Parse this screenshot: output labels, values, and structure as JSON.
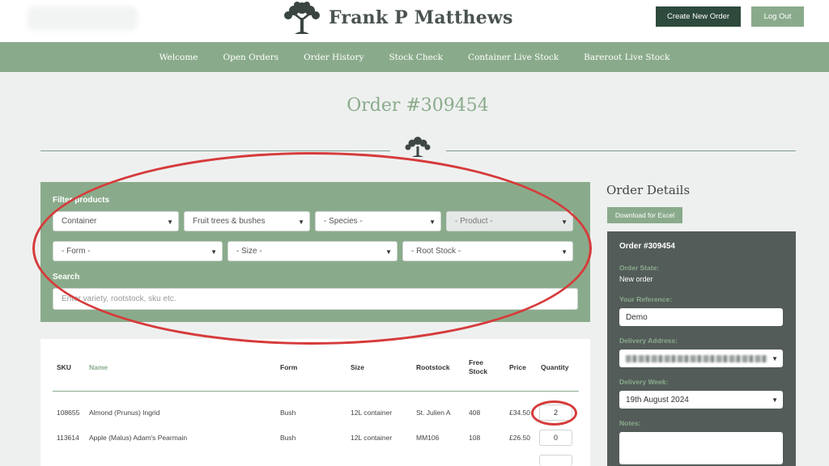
{
  "brand": {
    "name": "Frank P Matthews"
  },
  "header": {
    "new_order_label": "Create New Order",
    "logout_label": "Log Out"
  },
  "nav": [
    {
      "label": "Welcome"
    },
    {
      "label": "Open Orders"
    },
    {
      "label": "Order History"
    },
    {
      "label": "Stock Check"
    },
    {
      "label": "Container Live Stock"
    },
    {
      "label": "Bareroot Live Stock"
    }
  ],
  "page": {
    "title": "Order #309454"
  },
  "filters": {
    "label": "Filter products",
    "selects": [
      {
        "value": "Container"
      },
      {
        "value": "Fruit trees & bushes"
      },
      {
        "value": "- Species -"
      },
      {
        "value": "- Product -"
      },
      {
        "value": "- Form -"
      },
      {
        "value": "- Size -"
      },
      {
        "value": "- Root Stock -"
      }
    ],
    "search_label": "Search",
    "search_placeholder": "Enter variety, rootstock, sku etc."
  },
  "table": {
    "columns": [
      "SKU",
      "Name",
      "Form",
      "Size",
      "Rootstock",
      "Free Stock",
      "Price",
      "Quantity"
    ],
    "rows": [
      {
        "sku": "108655",
        "name": "Almond (Prunus) Ingrid",
        "form": "Bush",
        "size": "12L container",
        "rootstock": "St. Julien A",
        "free_stock": "408",
        "price": "£34.50",
        "quantity": "2"
      },
      {
        "sku": "113614",
        "name": "Apple (Malus) Adam's Pearmain",
        "form": "Bush",
        "size": "12L container",
        "rootstock": "MM106",
        "free_stock": "108",
        "price": "£26.50",
        "quantity": "0"
      }
    ]
  },
  "order_details": {
    "heading": "Order Details",
    "excel_label": "Download for Excel",
    "title": "Order #309454",
    "state_label": "Order State:",
    "state_value": "New order",
    "reference_label": "Your Reference:",
    "reference_value": "Demo",
    "address_label": "Delivery Address:",
    "week_label": "Delivery Week:",
    "week_value": "19th August 2024",
    "notes_label": "Notes:"
  },
  "colors": {
    "brand_green": "#8aab8b",
    "dark_green": "#2e4a3d",
    "panel_dark": "#535c59",
    "annotation_red": "#d63b3b"
  }
}
